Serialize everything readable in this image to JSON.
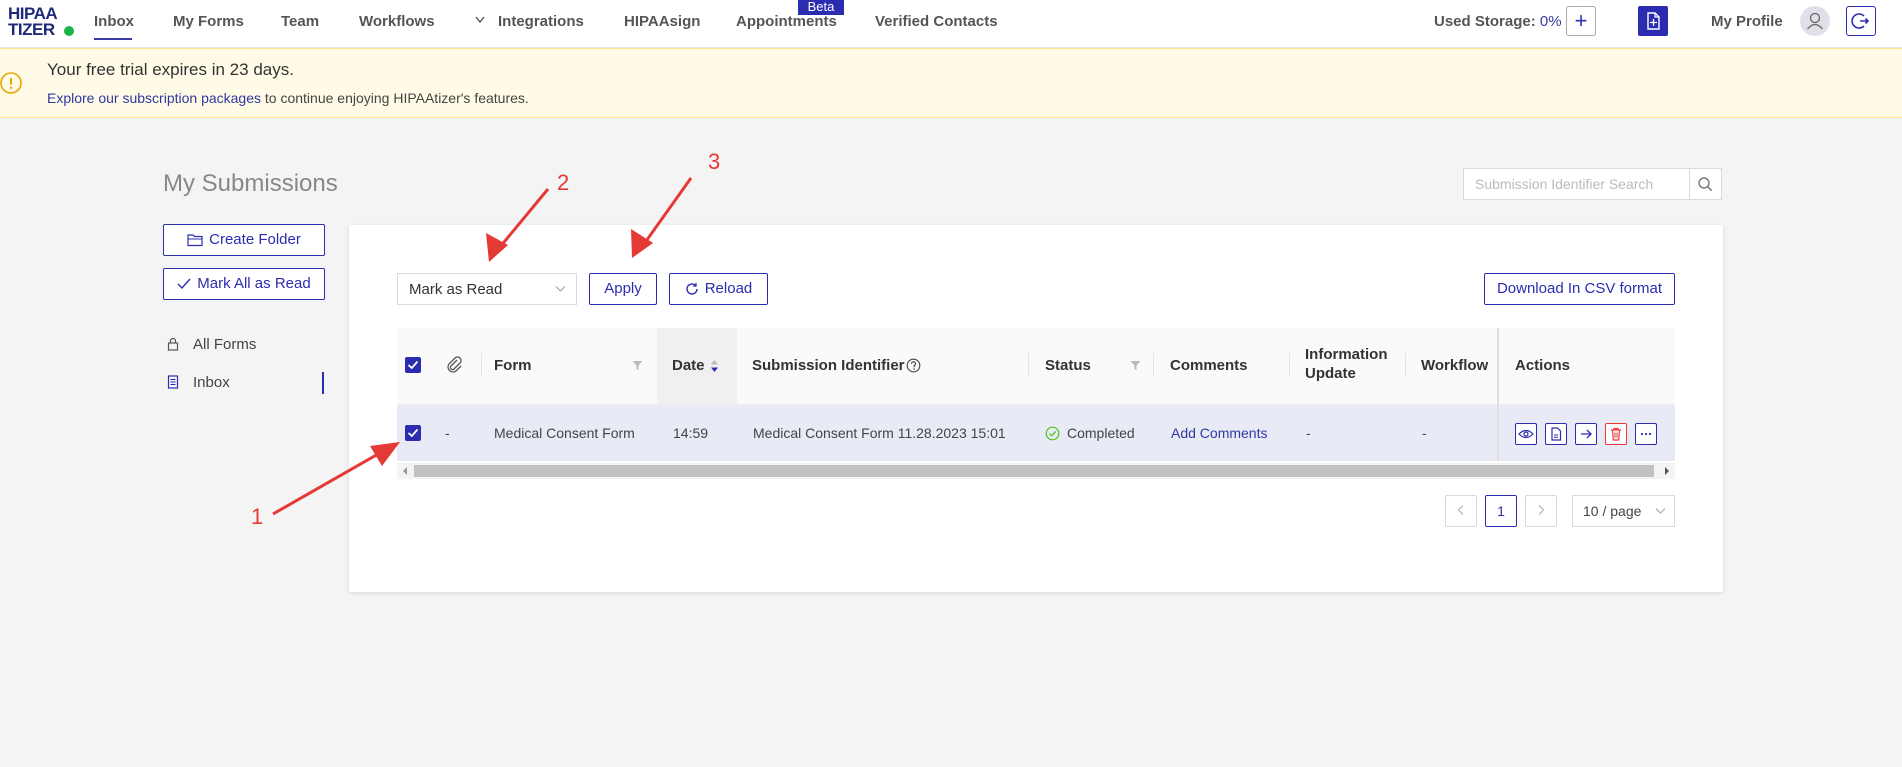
{
  "logo": {
    "line1": "HIPAA",
    "line2": "TIZER"
  },
  "nav": {
    "items": [
      {
        "label": "Inbox"
      },
      {
        "label": "My Forms"
      },
      {
        "label": "Team"
      },
      {
        "label": "Workflows"
      },
      {
        "label": "Integrations"
      },
      {
        "label": "HIPAAsign"
      },
      {
        "label": "Appointments"
      },
      {
        "label": "Verified Contacts"
      }
    ],
    "beta_badge": "Beta",
    "storage_label": "Used Storage:",
    "storage_value": "0%",
    "profile_label": "My Profile"
  },
  "banner": {
    "title": "Your free trial expires in 23 days.",
    "link_text": "Explore our subscription packages",
    "rest_text": " to continue enjoying HIPAAtizer's features."
  },
  "page": {
    "title": "My Submissions",
    "search_placeholder": "Submission Identifier Search"
  },
  "sidebar": {
    "create_folder": "Create Folder",
    "mark_all_read": "Mark All as Read",
    "items": [
      {
        "label": "All Forms"
      },
      {
        "label": "Inbox"
      }
    ]
  },
  "toolbar": {
    "bulk_action_value": "Mark as Read",
    "apply_label": "Apply",
    "reload_label": "Reload",
    "csv_label": "Download In CSV format"
  },
  "table": {
    "headers": {
      "form": "Form",
      "date": "Date",
      "submission_identifier": "Submission Identifier",
      "status": "Status",
      "comments": "Comments",
      "information_update_line1": "Information",
      "information_update_line2": "Update",
      "workflow": "Workflow",
      "actions": "Actions"
    },
    "rows": [
      {
        "attachment": "-",
        "form": "Medical Consent Form",
        "date": "14:59",
        "submission_identifier": "Medical Consent Form 11.28.2023 15:01",
        "status": "Completed",
        "comments": "Add Comments",
        "information_update": "-",
        "workflow": "-"
      }
    ]
  },
  "pagination": {
    "current_page": "1",
    "page_size": "10 / page"
  },
  "annotations": {
    "labels": [
      "1",
      "2",
      "3"
    ],
    "color": "#e53935"
  },
  "colors": {
    "primary": "#2c2cb0",
    "banner_bg": "#fffbe6",
    "success": "#52c41a",
    "danger": "#e53935"
  }
}
